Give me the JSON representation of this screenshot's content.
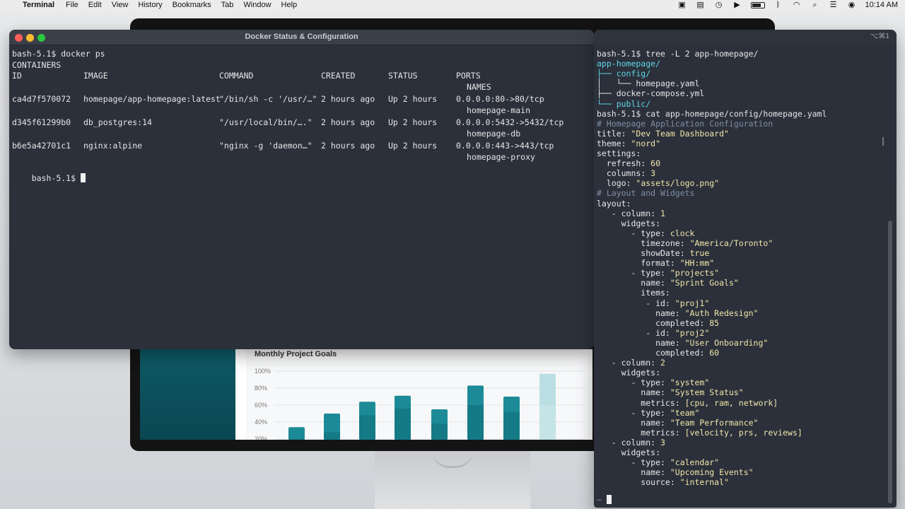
{
  "menubar": {
    "app_name": "Terminal",
    "items": [
      "File",
      "Edit",
      "View",
      "History",
      "Bookmarks",
      "Tab",
      "Window",
      "Help"
    ],
    "clock": "10:14 AM"
  },
  "left_window": {
    "title": "Docker Status & Configuration",
    "prompt": "bash-5.1$ docker ps",
    "section": "CONTAINERS",
    "headers": {
      "id": "ID",
      "image": "IMAGE",
      "command": "COMMAND",
      "created": "CREATED",
      "status": "STATUS",
      "ports": "PORTS",
      "names": "NAMES"
    },
    "rows": [
      {
        "id": "ca4d7f570072",
        "image": "homepage/app-homepage:latest",
        "command": "\"/bin/sh -c '/usr/…\"",
        "created": "2 hours ago",
        "status": "Up 2 hours",
        "ports": "0.0.0.0:80->80/tcp",
        "name": "homepage-main"
      },
      {
        "id": "d345f61299b0",
        "image": "db_postgres:14",
        "command": "\"/usr/local/bin/….\"",
        "created": "2 hours ago",
        "status": "Up 2 hours",
        "ports": "0.0.0.0:5432->5432/tcp",
        "name": "homepage-db"
      },
      {
        "id": "b6e5a42701c1",
        "image": "nginx:alpine",
        "command": "\"nginx -g 'daemon…\"",
        "created": "2 hours ago",
        "status": "Up 2 hours",
        "ports": "0.0.0.0:443->443/tcp",
        "name": "homepage-proxy"
      }
    ],
    "final_prompt": "bash-5.1$ "
  },
  "right_window": {
    "shortcut": "⌥⌘1",
    "tree_prompt": "bash-5.1$ tree -L 2 app-homepage/",
    "tree": [
      {
        "text": "app-homepage/",
        "kind": "dir"
      },
      {
        "text": "├── config/",
        "kind": "dir"
      },
      {
        "text": "│   └── homepage.yaml",
        "kind": "file"
      },
      {
        "text": "├── docker-compose.yml",
        "kind": "file"
      },
      {
        "text": "└── public/",
        "kind": "dir"
      }
    ],
    "cat_prompt": "bash-5.1$ cat app-homepage/config/homepage.yaml",
    "yaml": [
      {
        "k": "",
        "v": "# Homepage Application Configuration",
        "t": "comment"
      },
      {
        "k": "title: ",
        "v": "\"Dev Team Dashboard\"",
        "t": "str"
      },
      {
        "k": "theme: ",
        "v": "\"nord\"",
        "t": "str"
      },
      {
        "k": "settings:",
        "v": "",
        "t": "key"
      },
      {
        "k": "  refresh: ",
        "v": "60",
        "t": "num"
      },
      {
        "k": "  columns: ",
        "v": "3",
        "t": "num"
      },
      {
        "k": "  logo: ",
        "v": "\"assets/logo.png\"",
        "t": "str"
      },
      {
        "k": "",
        "v": "# Layout and Widgets",
        "t": "comment"
      },
      {
        "k": "layout:",
        "v": "",
        "t": "key"
      },
      {
        "k": "   - column: ",
        "v": "1",
        "t": "num"
      },
      {
        "k": "     widgets:",
        "v": "",
        "t": "key"
      },
      {
        "k": "       - type: ",
        "v": "clock",
        "t": "str"
      },
      {
        "k": "         timezone: ",
        "v": "\"America/Toronto\"",
        "t": "str"
      },
      {
        "k": "         showDate: ",
        "v": "true",
        "t": "str"
      },
      {
        "k": "         format: ",
        "v": "\"HH:mm\"",
        "t": "str"
      },
      {
        "k": "       - type: ",
        "v": "\"projects\"",
        "t": "str"
      },
      {
        "k": "         name: ",
        "v": "\"Sprint Goals\"",
        "t": "str"
      },
      {
        "k": "         items:",
        "v": "",
        "t": "key"
      },
      {
        "k": "          - id: ",
        "v": "\"proj1\"",
        "t": "str"
      },
      {
        "k": "            name: ",
        "v": "\"Auth Redesign\"",
        "t": "str"
      },
      {
        "k": "            completed: ",
        "v": "85",
        "t": "num"
      },
      {
        "k": "          - id: ",
        "v": "\"proj2\"",
        "t": "str"
      },
      {
        "k": "            name: ",
        "v": "\"User Onboarding\"",
        "t": "str"
      },
      {
        "k": "            completed: ",
        "v": "60",
        "t": "num"
      },
      {
        "k": "   - column: ",
        "v": "2",
        "t": "num"
      },
      {
        "k": "     widgets:",
        "v": "",
        "t": "key"
      },
      {
        "k": "       - type: ",
        "v": "\"system\"",
        "t": "str"
      },
      {
        "k": "         name: ",
        "v": "\"System Status\"",
        "t": "str"
      },
      {
        "k": "         metrics: ",
        "v": "[cpu, ram, network]",
        "t": "str"
      },
      {
        "k": "       - type: ",
        "v": "\"team\"",
        "t": "str"
      },
      {
        "k": "         name: ",
        "v": "\"Team Performance\"",
        "t": "str"
      },
      {
        "k": "         metrics: ",
        "v": "[velocity, prs, reviews]",
        "t": "str"
      },
      {
        "k": "   - column: ",
        "v": "3",
        "t": "num"
      },
      {
        "k": "     widgets:",
        "v": "",
        "t": "key"
      },
      {
        "k": "       - type: ",
        "v": "\"calendar\"",
        "t": "str"
      },
      {
        "k": "         name: ",
        "v": "\"Upcoming Events\"",
        "t": "str"
      },
      {
        "k": "         source: ",
        "v": "\"internal\"",
        "t": "str"
      }
    ],
    "bottom_prompt": "~ "
  },
  "background_dashboard": {
    "chart_title": "Monthly Project Goals",
    "chart_data": {
      "type": "bar",
      "title": "Monthly Project Goals",
      "y_ticks": [
        "100%",
        "80%",
        "60%",
        "40%",
        "20%"
      ],
      "ylim": [
        0,
        100
      ],
      "values": [
        34,
        50,
        64,
        71,
        55,
        83,
        70,
        97
      ],
      "inner_values": [
        20,
        28,
        48,
        56,
        38,
        60,
        52,
        60
      ]
    },
    "colors": {
      "bar": "#1c8b97",
      "bar_dark": "#0f6e79",
      "bar_light": "#b9dfe3",
      "sidebar": "#0e5a66"
    }
  }
}
